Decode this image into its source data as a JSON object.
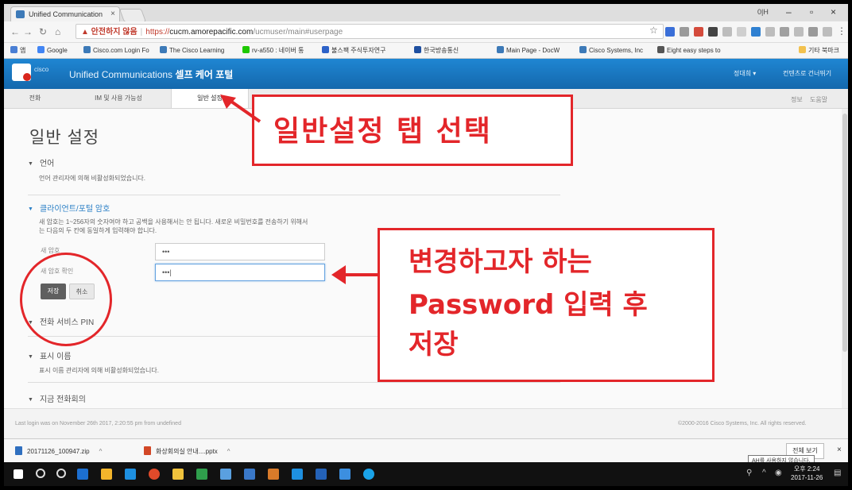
{
  "browser": {
    "tab_title": "Unified Communication",
    "tab_close": "×",
    "user_label": "0|H",
    "url_warning": "▲ 안전하지 않음",
    "url_scheme": "https://",
    "url_host": "cucm.amorepacific.com",
    "url_path": "/ucmuser/main#userpage",
    "bookmarks": [
      {
        "label": "앱",
        "color": "#4a7fd4"
      },
      {
        "label": "Google",
        "color": "#4285f4"
      },
      {
        "label": "Cisco.com Login Fo",
        "color": "#3d7ab8"
      },
      {
        "label": "The Cisco Learning",
        "color": "#3d7ab8"
      },
      {
        "label": "rv-a550 : 네이버 통",
        "color": "#1ec800"
      },
      {
        "label": "불스팩 주식투자연구",
        "color": "#2d62c8"
      },
      {
        "label": "한국방송통신",
        "color": "#1e4fa0"
      },
      {
        "label": "Main Page - DocW",
        "color": "#3d7ab8"
      },
      {
        "label": "Cisco Systems, Inc",
        "color": "#3d7ab8"
      },
      {
        "label": "Eight easy steps to",
        "color": "#555555"
      },
      {
        "label": "기타 북마크",
        "color": "#f2c14e"
      }
    ]
  },
  "app": {
    "cisco_word": "cisco",
    "title_prefix": "Unified Communications",
    "title_bold": "셀프 케어 포털",
    "header_user": "정대희 ▾",
    "header_help": "컨텐츠로 건너뛰기"
  },
  "tabs": [
    {
      "label": "전화"
    },
    {
      "label": "IM 및 사용 가능성"
    },
    {
      "label": "일반 설정"
    }
  ],
  "tabs_right": [
    "정보",
    "도움말"
  ],
  "page": {
    "title": "일반 설정",
    "language_header": "언어",
    "language_text": "언어 관리자에 의해 비활성화되었습니다.",
    "password_header": "클라이언트/포털 암호",
    "password_help_1": "새 암호는 1~256자의 숫자여야 하고 공백을 사용해서는 안 됩니다. 새로운 비밀번호를 전송하기 위해서",
    "password_help_2": "는 다음의 두 칸에 동일하게 입력해야 합니다.",
    "new_pw_label": "새 암호",
    "confirm_pw_label": "새 암호 확인",
    "new_pw_value": "•••",
    "confirm_pw_value": "•••|",
    "save_label": "저장",
    "cancel_label": "취소",
    "phone_services_header": "전화 서비스 PIN",
    "display_name_header": "표시 이름",
    "display_name_text": "표시 이름 관리자에 의해 비활성화되었습니다.",
    "conference_header": "지금 전화회의"
  },
  "footer": {
    "last_login": "Last login was on November 26th 2017, 2:20:55 pm from undefined",
    "copyright": "©2000-2016 Cisco Systems, Inc. All rights reserved."
  },
  "downloads": {
    "items": [
      {
        "name": "20171126_100947.zip",
        "color": "#2f6fbf"
      },
      {
        "name": "화상회의실 안내....pptx",
        "color": "#d24726"
      }
    ],
    "chevron": "^",
    "show_all": "전체 보기",
    "close": "×",
    "tooltip": "AH를 사용하지 않습니다."
  },
  "taskbar": {
    "time": "오후 2:24",
    "date": "2017-11-26"
  },
  "annotations": {
    "tab_callout": "일반설정 탭 선택",
    "pw_callout_1": "변경하고자 하는",
    "pw_callout_2": "Password 입력 후",
    "pw_callout_3": "저장",
    "accent_color": "#e3262a"
  }
}
